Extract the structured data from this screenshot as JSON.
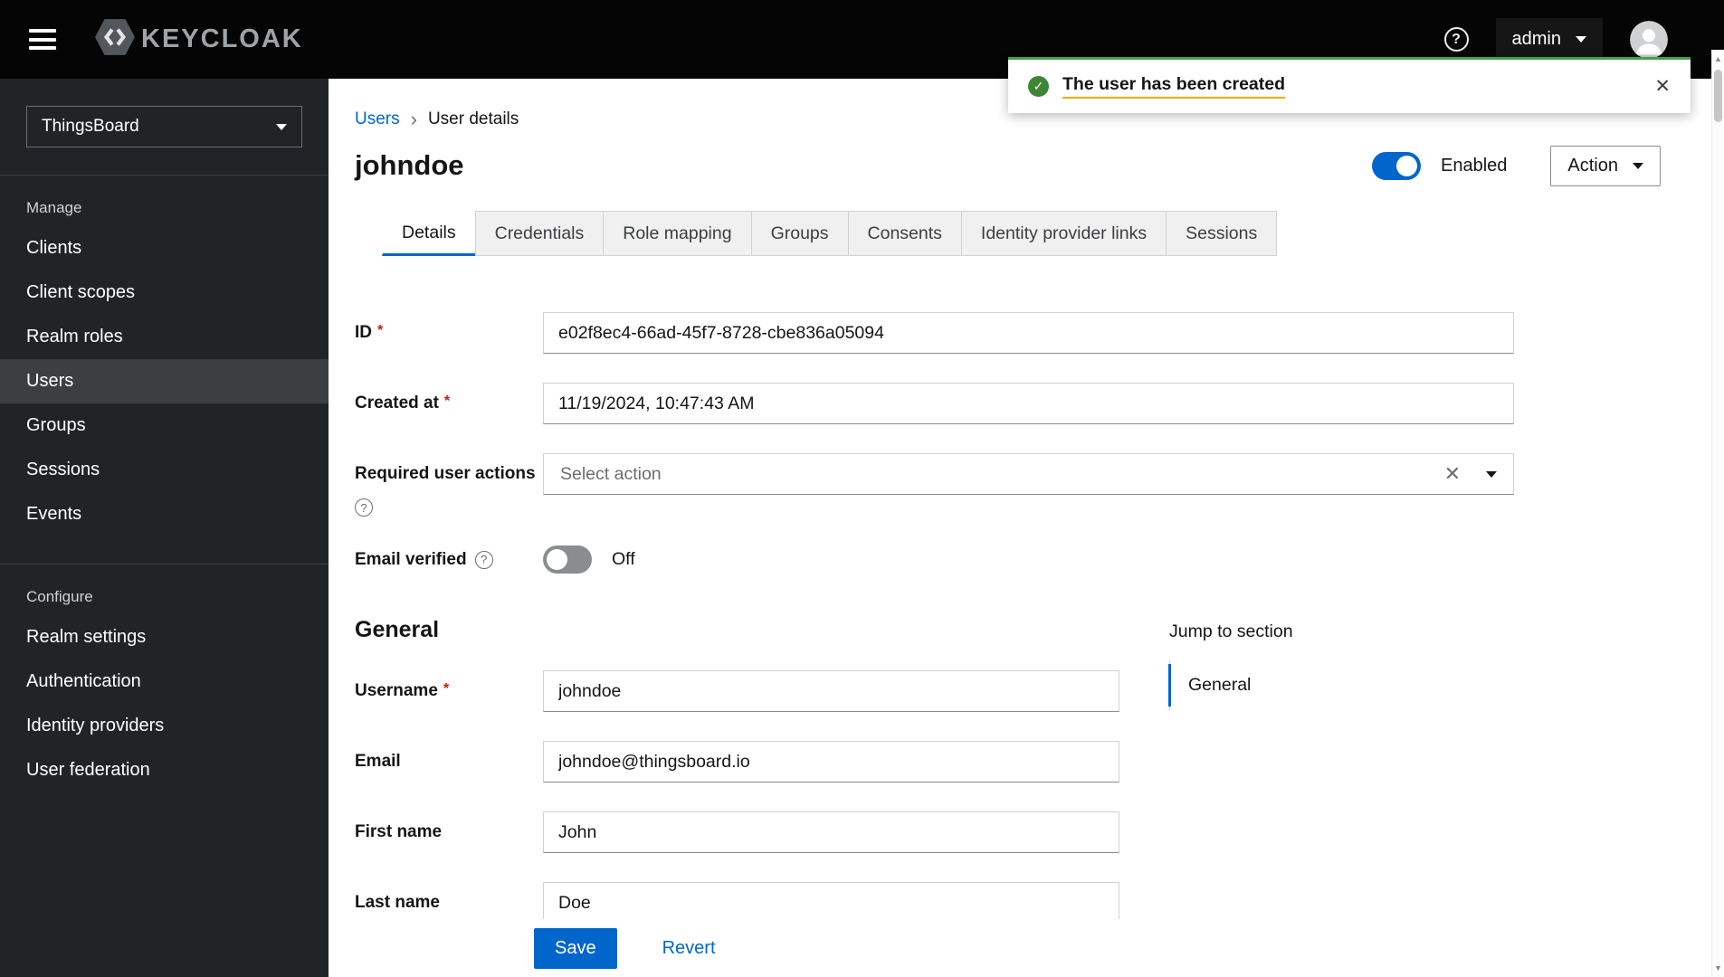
{
  "topbar": {
    "brand": "KEYCLOAK",
    "user_menu": "admin"
  },
  "toast": {
    "message": "The user has been created"
  },
  "sidebar": {
    "realm_selector": "ThingsBoard",
    "active_item": "Users",
    "sections": [
      {
        "label": "Manage",
        "items": [
          "Clients",
          "Client scopes",
          "Realm roles",
          "Users",
          "Groups",
          "Sessions",
          "Events"
        ]
      },
      {
        "label": "Configure",
        "items": [
          "Realm settings",
          "Authentication",
          "Identity providers",
          "User federation"
        ]
      }
    ]
  },
  "breadcrumb": {
    "parent": "Users",
    "current": "User details"
  },
  "header": {
    "title": "johndoe",
    "enabled_label": "Enabled",
    "action_label": "Action"
  },
  "tabs": [
    "Details",
    "Credentials",
    "Role mapping",
    "Groups",
    "Consents",
    "Identity provider links",
    "Sessions"
  ],
  "active_tab": "Details",
  "form": {
    "id_label": "ID",
    "id_value": "e02f8ec4-66ad-45f7-8728-cbe836a05094",
    "created_at_label": "Created at",
    "created_at_value": "11/19/2024, 10:47:43 AM",
    "required_actions_label": "Required user actions",
    "required_actions_placeholder": "Select action",
    "email_verified_label": "Email verified",
    "email_verified_state": "Off",
    "section_general": "General",
    "username_label": "Username",
    "username_value": "johndoe",
    "email_label": "Email",
    "email_value": "johndoe@thingsboard.io",
    "first_name_label": "First name",
    "first_name_value": "John",
    "last_name_label": "Last name",
    "last_name_value": "Doe"
  },
  "jump_to_section": {
    "heading": "Jump to section",
    "items": [
      "General"
    ]
  },
  "actions": {
    "save": "Save",
    "revert": "Revert"
  },
  "icons": {
    "check": "✓",
    "close": "✕",
    "clear": "✕",
    "question_mark": "?",
    "breadcrumb_separator": "›",
    "scroll_up": "▲",
    "scroll_down": "▼"
  },
  "colors": {
    "accent_blue": "#0066cc",
    "success_green": "#3e8635",
    "danger_red": "#c9190b",
    "sidebar_bg": "#212427",
    "masthead_bg": "#050505"
  }
}
